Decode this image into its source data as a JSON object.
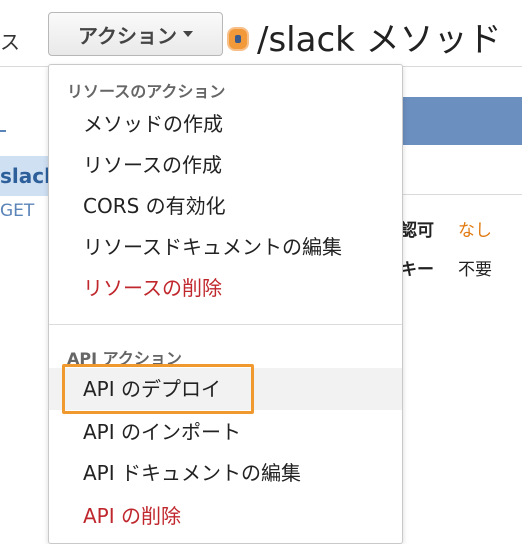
{
  "background": {
    "left_fragment": "ス",
    "actions_button": "アクション",
    "page_title": "/slack メソッド",
    "tree_resource": "slack",
    "tree_method": "GET",
    "auth_label": "認可",
    "auth_value": "なし",
    "api_key_label": "キー",
    "api_key_value": "不要"
  },
  "menu": {
    "resource_header": "リソースのアクション",
    "resource_items": [
      {
        "label": "メソッドの作成"
      },
      {
        "label": "リソースの作成"
      },
      {
        "label": "CORS の有効化"
      },
      {
        "label": "リソースドキュメントの編集"
      },
      {
        "label": "リソースの削除"
      }
    ],
    "api_header": "API アクション",
    "api_items": [
      {
        "label": "API のデプロイ"
      },
      {
        "label": "API のインポート"
      },
      {
        "label": "API ドキュメントの編集"
      },
      {
        "label": "API の削除"
      }
    ]
  },
  "colors": {
    "highlight": "#f0992e",
    "danger": "#c0272d",
    "auth_value": "#e07a10",
    "tree_selected": "#cfe0f3"
  }
}
